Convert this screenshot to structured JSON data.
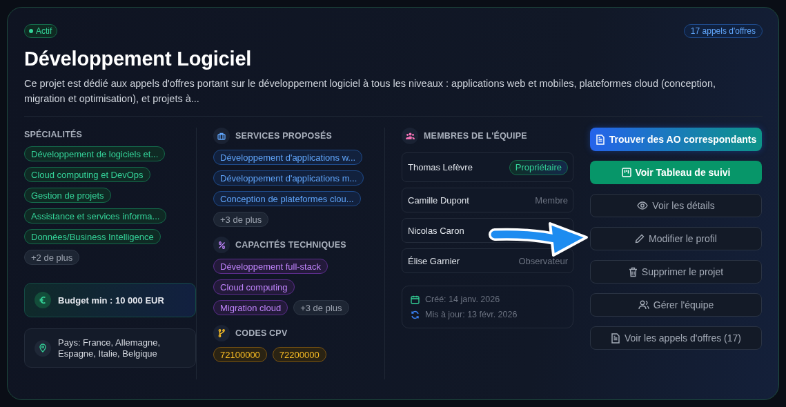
{
  "status": {
    "label": "Actif",
    "active": true
  },
  "count_badge": "17 appels d'offres",
  "title": "Développement Logiciel",
  "description": "Ce projet est dédié aux appels d'offres portant sur le développement logiciel à tous les niveaux : applications web et mobiles, plateformes cloud (conception, migration et optimisation), et projets à...",
  "specialites": {
    "title": "SPÉCIALITÉS",
    "tags": [
      "Développement de logiciels et...",
      "Cloud computing et DevOps",
      "Gestion de projets",
      "Assistance et services informa...",
      "Données/Business Intelligence"
    ],
    "more": "+2 de plus"
  },
  "budget": "Budget min : 10 000 EUR",
  "pays": "Pays: France, Allemagne, Espagne, Italie, Belgique",
  "services": {
    "title": "SERVICES PROPOSÉS",
    "tags": [
      "Développement d'applications w...",
      "Développement d'applications m...",
      "Conception de plateformes clou..."
    ],
    "more": "+3 de plus"
  },
  "capacites": {
    "title": "CAPACITÉS TECHNIQUES",
    "tags": [
      "Développement full-stack",
      "Cloud computing",
      "Migration cloud"
    ],
    "more": "+3 de plus"
  },
  "cpv": {
    "title": "CODES CPV",
    "codes": [
      "72100000",
      "72200000"
    ]
  },
  "team": {
    "title": "MEMBRES DE L'ÉQUIPE",
    "members": [
      {
        "name": "Thomas Lefèvre",
        "role": "Propriétaire",
        "kind": "owner"
      },
      {
        "name": "Camille Dupont",
        "role": "Membre",
        "kind": "member"
      },
      {
        "name": "Nicolas Caron"
      },
      {
        "name": "Élise Garnier",
        "role": "Observateur",
        "kind": "member"
      }
    ]
  },
  "dates": {
    "created": "Créé: 14 janv. 2026",
    "updated": "Mis à jour: 13 févr. 2026"
  },
  "actions": [
    {
      "label": "Trouver des AO correspondants",
      "kind": "gradient"
    },
    {
      "label": "Voir Tableau de suivi",
      "kind": "green"
    },
    {
      "label": "Voir les détails",
      "kind": "outline"
    },
    {
      "label": "Modifier le profil",
      "kind": "outline"
    },
    {
      "label": "Supprimer le projet",
      "kind": "outline"
    },
    {
      "label": "Gérer l'équipe",
      "kind": "outline"
    },
    {
      "label": "Voir les appels d'offres (17)",
      "kind": "outline"
    }
  ],
  "annotation": {
    "kind": "arrow"
  }
}
